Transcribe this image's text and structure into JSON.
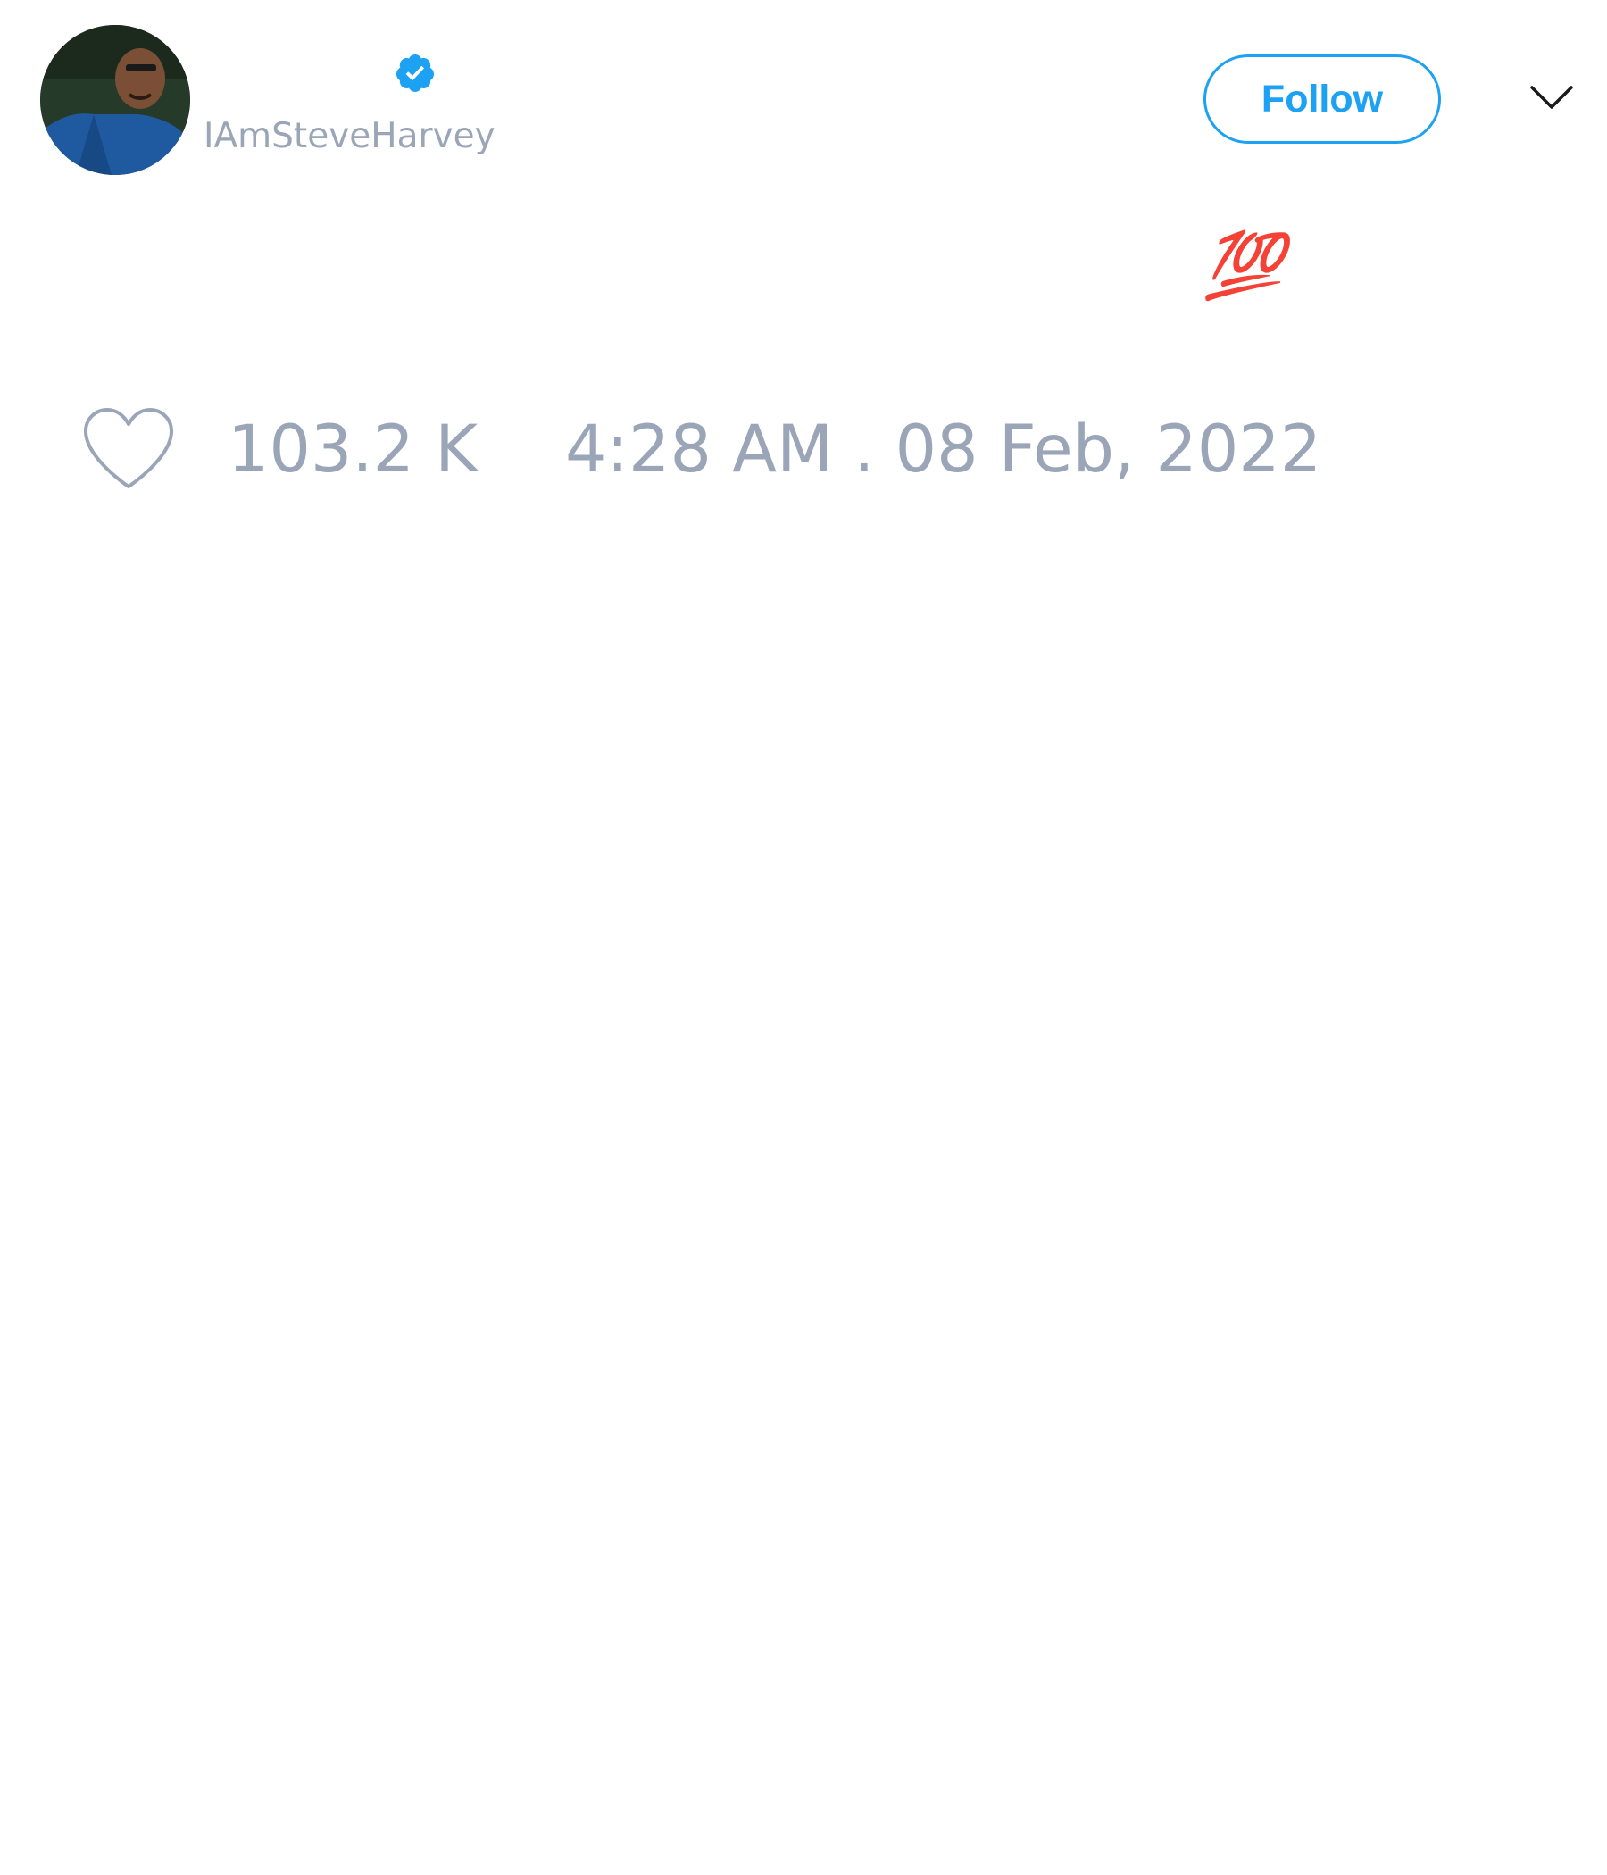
{
  "tweet": {
    "author": {
      "handle": "IAmSteveHarvey",
      "verified": true
    },
    "follow_label": "Follow",
    "text_emoji": "💯",
    "likes": "103.2 K",
    "timestamp": "4:28 AM . 08 Feb, 2022"
  },
  "colors": {
    "accent": "#1da1f2",
    "muted_text": "#9aa6b8",
    "emoji_red": "#e53935"
  },
  "icons": {
    "avatar": "avatar",
    "verified": "verified-badge-icon",
    "menu": "chevron-down-icon",
    "like": "heart-icon"
  }
}
